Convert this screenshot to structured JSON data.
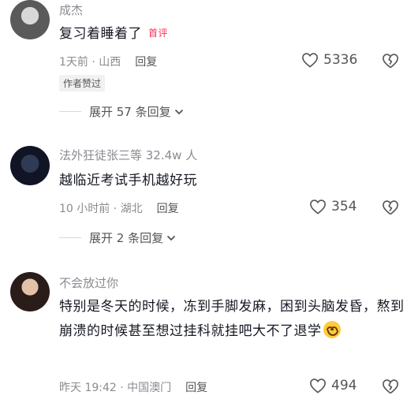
{
  "comments": [
    {
      "author": "成杰",
      "content": "复习着睡着了",
      "badge": "首评",
      "meta": "1天前 · 山西",
      "reply": "回复",
      "likes": "5336",
      "author_liked": "作者赞过",
      "expand": "展开 57 条回复"
    },
    {
      "author": "法外狂徒张三等 32.4w 人",
      "content": "越临近考试手机越好玩",
      "meta": "10 小时前 · 湖北",
      "reply": "回复",
      "likes": "354",
      "expand": "展开 2 条回复"
    },
    {
      "author": "不会放过你",
      "content": "特别是冬天的时候，冻到手脚发麻，困到头脑发昏，熬到崩溃的时候甚至想过挂科就挂吧大不了退学",
      "meta": "昨天 19:42 · 中国澳门",
      "reply": "回复",
      "likes": "494"
    }
  ],
  "icons": {
    "like": "heart-outline-icon",
    "dislike": "broken-heart-icon",
    "expand": "chevron-down-icon",
    "emoji": "smiling-face-emoji"
  },
  "colors": {
    "badge": "#fe2c55",
    "secondary_text": "#8a8b91"
  }
}
